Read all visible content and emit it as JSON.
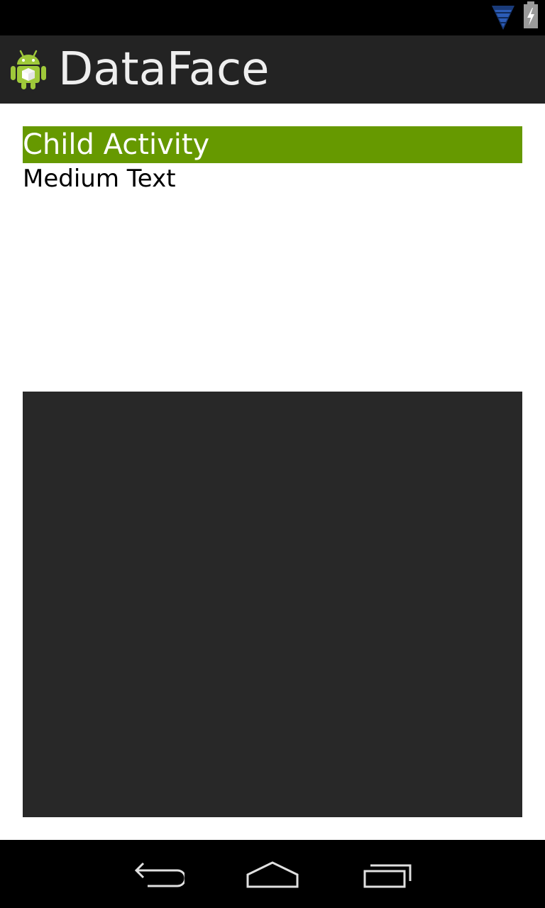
{
  "status_bar": {
    "icons": [
      "wifi-icon",
      "battery-charging-icon"
    ]
  },
  "action_bar": {
    "app_icon": "android-robot-icon",
    "title": "DataFace"
  },
  "content": {
    "header_text": "Child Activity",
    "body_text": "Medium Text"
  },
  "nav_bar": {
    "buttons": [
      "back-icon",
      "home-icon",
      "recents-icon"
    ]
  },
  "colors": {
    "accent_green": "#669900",
    "action_bar_bg": "#232323",
    "panel_bg": "#282828"
  }
}
